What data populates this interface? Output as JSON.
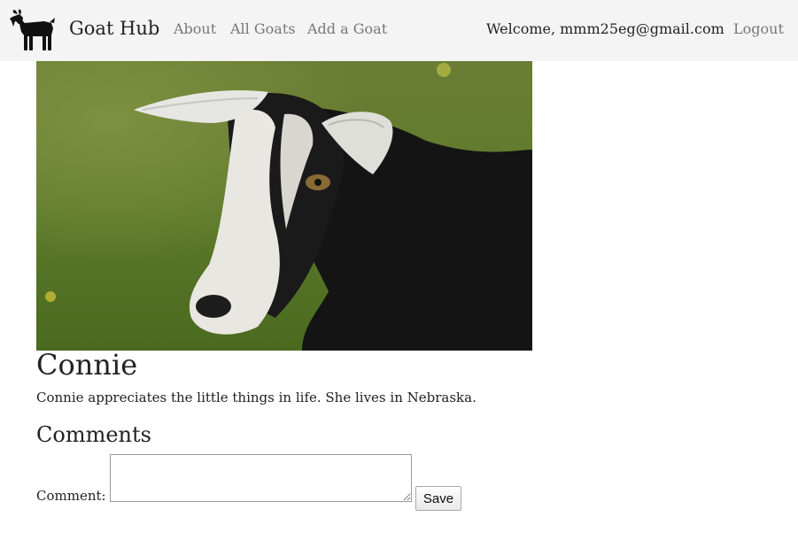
{
  "nav": {
    "logo_icon": "goat-silhouette-icon",
    "brand": "Goat Hub",
    "links": [
      "About",
      "All Goats",
      "Add a Goat"
    ],
    "welcome": "Welcome, mmm25eg@gmail.com",
    "logout": "Logout"
  },
  "goat": {
    "photo": "goat-photo",
    "name": "Connie",
    "description": "Connie appreciates the little things in life. She lives in Nebraska."
  },
  "comments": {
    "heading": "Comments",
    "label": "Comment:",
    "value": "",
    "save_label": "Save"
  },
  "colors": {
    "navbar_bg": "#f4f4f4",
    "link": "#777777",
    "text": "#222222"
  }
}
